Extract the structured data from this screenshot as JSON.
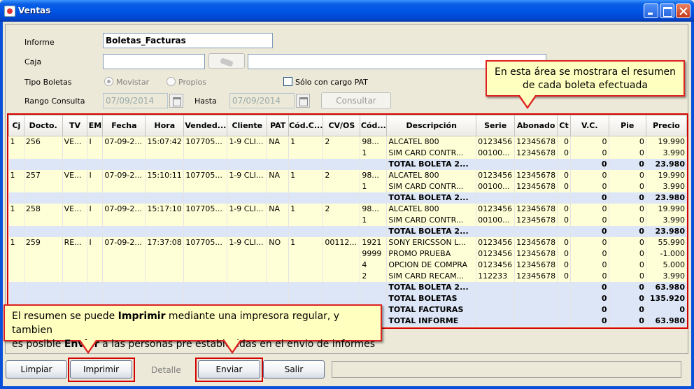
{
  "window": {
    "title": "Ventas"
  },
  "form": {
    "informe_label": "Informe",
    "informe_value": "Boletas_Facturas",
    "caja_label": "Caja",
    "tipo_label": "Tipo Boletas",
    "radio_movistar": "Movistar",
    "radio_propios": "Propios",
    "check_pat": "Sólo con cargo PAT",
    "rango_label": "Rango Consulta",
    "fecha_desde": "07/09/2014",
    "hasta_label": "Hasta",
    "fecha_hasta": "07/09/2014",
    "consultar": "Consultar"
  },
  "table": {
    "columns": [
      "Cj",
      "Docto.",
      "TV",
      "EM",
      "Fecha",
      "Hora",
      "Vended...",
      "Cliente",
      "PAT",
      "Cód.C...",
      "CV/OS",
      "Cód...",
      "Descripción",
      "Serie",
      "Abonado",
      "Ct",
      "V.C.",
      "Pie",
      "Precio"
    ],
    "rows": [
      {
        "type": "d",
        "cells": [
          "1",
          "256",
          "VE...",
          "I",
          "07-09-2...",
          "15:07:42",
          "107705...",
          "1-9 CLI...",
          "NA",
          "1",
          "2",
          "98...",
          "ALCATEL 800",
          "0123456",
          "12345678",
          "0",
          "0",
          "0",
          "19.990"
        ]
      },
      {
        "type": "d",
        "cells": [
          "",
          "",
          "",
          "",
          "",
          "",
          "",
          "",
          "",
          "",
          "",
          "1",
          "SIM CARD CONTR...",
          "00100...",
          "12345678",
          "0",
          "0",
          "0",
          "3.990"
        ]
      },
      {
        "type": "t",
        "cells": [
          "",
          "",
          "",
          "",
          "",
          "",
          "",
          "",
          "",
          "",
          "",
          "",
          "TOTAL BOLETA 2...",
          "",
          "",
          "",
          "0",
          "0",
          "23.980"
        ]
      },
      {
        "type": "d",
        "cells": [
          "1",
          "257",
          "VE...",
          "I",
          "07-09-2...",
          "15:10:11",
          "107705...",
          "1-9 CLI...",
          "NA",
          "1",
          "2",
          "98...",
          "ALCATEL 800",
          "0123456",
          "12345678",
          "0",
          "0",
          "0",
          "19.990"
        ]
      },
      {
        "type": "d",
        "cells": [
          "",
          "",
          "",
          "",
          "",
          "",
          "",
          "",
          "",
          "",
          "",
          "1",
          "SIM CARD CONTR...",
          "00100...",
          "12345678",
          "0",
          "0",
          "0",
          "3.990"
        ]
      },
      {
        "type": "t",
        "cells": [
          "",
          "",
          "",
          "",
          "",
          "",
          "",
          "",
          "",
          "",
          "",
          "",
          "TOTAL BOLETA 2...",
          "",
          "",
          "",
          "0",
          "0",
          "23.980"
        ]
      },
      {
        "type": "d",
        "cells": [
          "1",
          "258",
          "VE...",
          "I",
          "07-09-2...",
          "15:17:10",
          "107705...",
          "1-9 CLI...",
          "NA",
          "1",
          "2",
          "98...",
          "ALCATEL 800",
          "0123456",
          "12345678",
          "0",
          "0",
          "0",
          "19.990"
        ]
      },
      {
        "type": "d",
        "cells": [
          "",
          "",
          "",
          "",
          "",
          "",
          "",
          "",
          "",
          "",
          "",
          "1",
          "SIM CARD CONTR...",
          "00100...",
          "12345678",
          "0",
          "0",
          "0",
          "3.990"
        ]
      },
      {
        "type": "t",
        "cells": [
          "",
          "",
          "",
          "",
          "",
          "",
          "",
          "",
          "",
          "",
          "",
          "",
          "TOTAL BOLETA 2...",
          "",
          "",
          "",
          "0",
          "0",
          "23.980"
        ]
      },
      {
        "type": "d",
        "cells": [
          "1",
          "259",
          "RE...",
          "I",
          "07-09-2...",
          "17:37:08",
          "107705...",
          "1-9 CLI...",
          "NO",
          "1",
          "00112...",
          "1921",
          "SONY ERICSSON L...",
          "0123456",
          "12345678",
          "0",
          "0",
          "0",
          "55.990"
        ]
      },
      {
        "type": "d",
        "cells": [
          "",
          "",
          "",
          "",
          "",
          "",
          "",
          "",
          "",
          "",
          "",
          "9999",
          "PROMO PRUEBA",
          "0123456",
          "12345678",
          "0",
          "0",
          "0",
          "-1.000"
        ]
      },
      {
        "type": "d",
        "cells": [
          "",
          "",
          "",
          "",
          "",
          "",
          "",
          "",
          "",
          "",
          "",
          "4",
          "OPCION DE COMPRA",
          "0123456",
          "12345678",
          "0",
          "0",
          "0",
          "5.000"
        ]
      },
      {
        "type": "d",
        "cells": [
          "",
          "",
          "",
          "",
          "",
          "",
          "",
          "",
          "",
          "",
          "",
          "2",
          "SIM CARD RECAM...",
          "112233",
          "12345678",
          "0",
          "0",
          "0",
          "3.990"
        ]
      },
      {
        "type": "t",
        "cells": [
          "",
          "",
          "",
          "",
          "",
          "",
          "",
          "",
          "",
          "",
          "",
          "",
          "TOTAL BOLETA 2...",
          "",
          "",
          "",
          "0",
          "0",
          "63.980"
        ]
      },
      {
        "type": "t",
        "cells": [
          "",
          "",
          "",
          "",
          "",
          "",
          "",
          "",
          "",
          "",
          "",
          "",
          "TOTAL BOLETAS",
          "",
          "",
          "",
          "0",
          "0",
          "135.920"
        ]
      },
      {
        "type": "t",
        "cells": [
          "",
          "",
          "",
          "",
          "",
          "",
          "",
          "",
          "",
          "",
          "",
          "",
          "TOTAL FACTURAS",
          "",
          "",
          "",
          "0",
          "0",
          "0"
        ]
      },
      {
        "type": "t",
        "cells": [
          "",
          "",
          "",
          "",
          "",
          "",
          "",
          "",
          "",
          "",
          "",
          "",
          "TOTAL INFORME",
          "",
          "",
          "",
          "0",
          "0",
          "63.980"
        ]
      }
    ]
  },
  "buttons": {
    "limpiar": "Limpiar",
    "imprimir": "Imprimir",
    "detalle": "Detalle",
    "enviar": "Enviar",
    "salir": "Salir"
  },
  "callouts": {
    "top_line1": "En esta área se mostrara el resumen",
    "top_line2": "de cada boleta efectuada",
    "bottom_p1": "El resumen se puede ",
    "bottom_b1": "Imprimir",
    "bottom_p2": " mediante una impresora regular, y tambien",
    "bottom_p3": "es posible ",
    "bottom_b2": "Enviar",
    "bottom_p4": " a las personas pre establecidas en el envio de informes"
  },
  "colors": {
    "titlebar": "#0055e5",
    "highlight": "#d40000",
    "callout_bg": "#ffffc0",
    "row_detail": "#ffffd7",
    "row_total": "#dce6f6"
  }
}
